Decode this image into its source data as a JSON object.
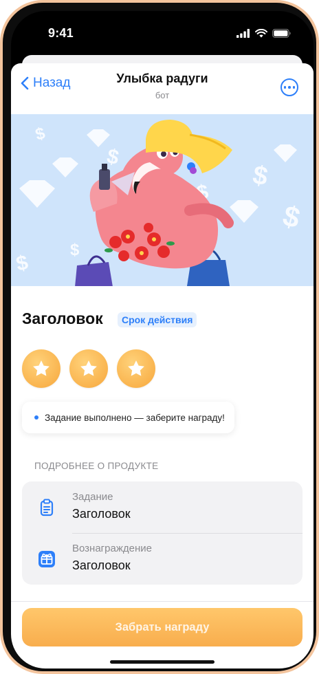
{
  "status_bar": {
    "time": "9:41"
  },
  "nav": {
    "back_label": "Назад",
    "title": "Улыбка радуги",
    "subtitle": "бот"
  },
  "content": {
    "heading": "Заголовок",
    "badge": "Срок действия",
    "stars_count": 3,
    "notice": "Задание выполнено — заберите награду!",
    "section_header": "ПОДРОБНЕЕ О ПРОДУКТЕ"
  },
  "details": [
    {
      "icon": "clipboard-icon",
      "label": "Задание",
      "value": "Заголовок"
    },
    {
      "icon": "gift-icon",
      "label": "Вознаграждение",
      "value": "Заголовок"
    }
  ],
  "cta": {
    "label": "Забрать награду"
  },
  "colors": {
    "accent": "#2d7ff9",
    "cta": "#f8ad4d",
    "banner_bg": "#cfe4fb",
    "device_frame": "#f3c49d"
  }
}
